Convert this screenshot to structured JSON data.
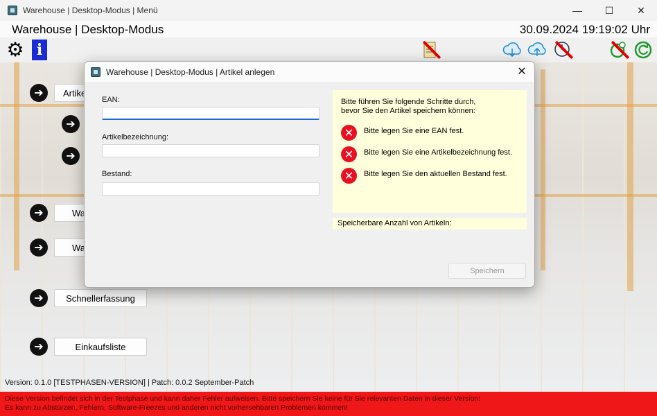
{
  "window": {
    "title": "Warehouse | Desktop-Modus | Menü",
    "minimize": "—",
    "maximize": "☐",
    "close": "✕"
  },
  "header": {
    "app_title": "Warehouse | Desktop-Modus",
    "datetime": "30.09.2024 19:19:02 Uhr"
  },
  "toolbar": {
    "settings_icon": "gear-icon",
    "info_icon": "info-icon",
    "info_glyph": "i",
    "gear_glyph": "⚙",
    "right_icons": [
      "document-disabled-icon",
      "cloud-download-icon",
      "cloud-upload-icon",
      "clock-disabled-icon",
      "timer-disabled-icon",
      "refresh-icon"
    ]
  },
  "menu": {
    "arrow_glyph": "➔",
    "items": [
      {
        "label": "Artikel"
      },
      {
        "label": ""
      },
      {
        "label": ""
      },
      {
        "label": "Wa"
      },
      {
        "label": "Wa"
      },
      {
        "label": "Schnellerfassung"
      },
      {
        "label": "Einkaufsliste"
      }
    ]
  },
  "footer": {
    "version": "Version: 0.1.0 [TESTPHASEN-VERSION]  |  Patch: 0.0.2 September-Patch",
    "warning_line1": "Diese Version befindet sich in der Testphase und kann daher Fehler aufweisen. Bitte speichern Sie keine für Sie relevanten Daten in dieser Version!",
    "warning_line2": "Es kann zu Abstürzen, Fehlern, Software-Freezes und anderen nicht vorhersehbaren Problemen kommen!"
  },
  "dialog": {
    "title": "Warehouse | Desktop-Modus | Artikel anlegen",
    "close": "✕",
    "fields": {
      "ean_label": "EAN:",
      "ean_value": "",
      "name_label": "Artikelbezeichnung:",
      "name_value": "",
      "stock_label": "Bestand:",
      "stock_value": ""
    },
    "hint": {
      "intro_line1": "Bitte führen Sie folgende Schritte durch,",
      "intro_line2": "bevor Sie den Artikel speichern können:",
      "err_glyph": "✕",
      "errors": [
        "Bitte legen Sie eine EAN fest.",
        "Bitte legen Sie eine Artikelbezeichnung fest.",
        "Bitte legen Sie den aktuellen Bestand fest."
      ]
    },
    "save_count_label": "Speicherbare Anzahl von Artikeln:",
    "save_button": "Speichern"
  },
  "colors": {
    "warning_bg": "#ef1717",
    "error_icon": "#e81123",
    "hint_bg": "#ffffdc",
    "info_blue": "#1a2bd6",
    "focus_blue": "#1c6ad3"
  }
}
